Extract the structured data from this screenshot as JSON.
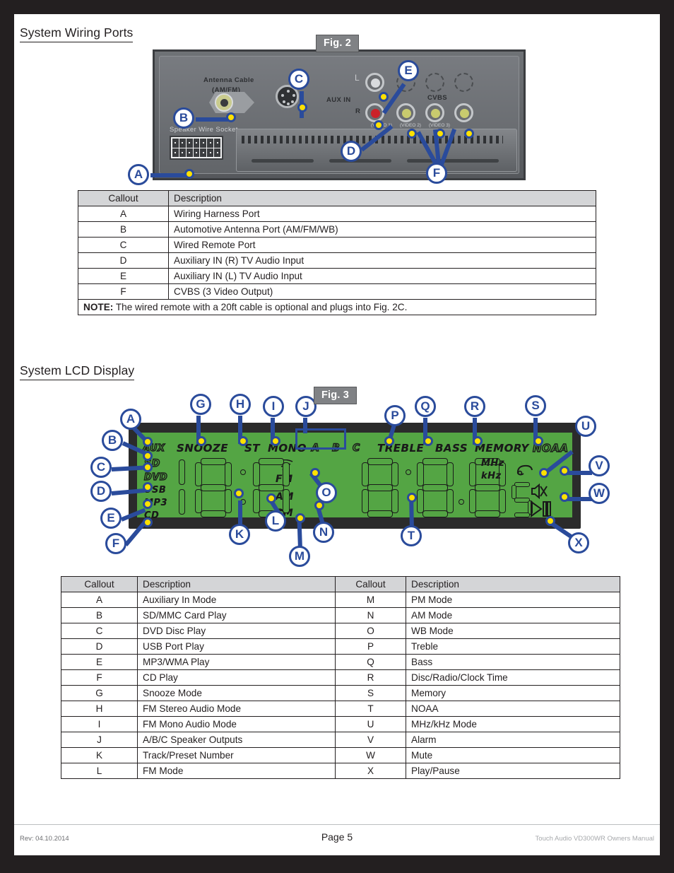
{
  "sections": {
    "wiring_title": "System Wiring Ports",
    "lcd_title": "System LCD Display"
  },
  "fig2": {
    "label": "Fig. 2",
    "panel_labels": {
      "antenna": "Antenna Cable",
      "antenna_sub": "(AM/FM)",
      "speaker_socket": "Speaker Wire Socket",
      "aux_in": "AUX IN",
      "left": "L",
      "right": "R",
      "cvbs": "CVBS",
      "video1": "(VIDEO 1)",
      "video2": "(VIDEO 2)",
      "video3": "(VIDEO 3)"
    },
    "callouts": [
      "A",
      "B",
      "C",
      "D",
      "E",
      "F"
    ]
  },
  "fig3": {
    "label": "Fig. 3",
    "lcd_labels": {
      "aux": "AUX",
      "sd": "SD",
      "dvd": "DVD",
      "usb": "USB",
      "mp3": "MP3",
      "cd": "CD",
      "snooze": "SNOOZE",
      "st": "ST",
      "mono": "MONO",
      "spk_a": "A",
      "spk_b": "B",
      "spk_c": "C",
      "treble": "TREBLE",
      "bass": "BASS",
      "memory": "MEMORY",
      "noaa": "NOAA",
      "mhz": "MHz",
      "khz": "kHz",
      "fm": "FM",
      "am": "AM",
      "pm": "PM"
    },
    "callouts": [
      "A",
      "B",
      "C",
      "D",
      "E",
      "F",
      "G",
      "H",
      "I",
      "J",
      "K",
      "L",
      "M",
      "N",
      "O",
      "P",
      "Q",
      "R",
      "S",
      "T",
      "U",
      "V",
      "W",
      "X"
    ]
  },
  "table1": {
    "headers": [
      "Callout",
      "Description"
    ],
    "rows": [
      [
        "A",
        "Wiring Harness Port"
      ],
      [
        "B",
        "Automotive Antenna Port (AM/FM/WB)"
      ],
      [
        "C",
        "Wired Remote Port"
      ],
      [
        "D",
        "Auxiliary IN (R) TV Audio Input"
      ],
      [
        "E",
        "Auxiliary IN (L) TV Audio Input"
      ],
      [
        "F",
        "CVBS (3 Video Output)"
      ]
    ],
    "note_label": "NOTE:",
    "note_text": " The wired remote with a 20ft cable is optional and plugs into Fig. 2C."
  },
  "table2": {
    "headers": [
      "Callout",
      "Description",
      "Callout",
      "Description"
    ],
    "rows": [
      [
        "A",
        "Auxiliary In Mode",
        "M",
        "PM Mode"
      ],
      [
        "B",
        "SD/MMC Card Play",
        "N",
        "AM Mode"
      ],
      [
        "C",
        "DVD Disc Play",
        "O",
        "WB Mode"
      ],
      [
        "D",
        "USB Port Play",
        "P",
        "Treble"
      ],
      [
        "E",
        "MP3/WMA Play",
        "Q",
        "Bass"
      ],
      [
        "F",
        "CD Play",
        "R",
        "Disc/Radio/Clock Time"
      ],
      [
        "G",
        "Snooze Mode",
        "S",
        "Memory"
      ],
      [
        "H",
        "FM Stereo Audio Mode",
        "T",
        "NOAA"
      ],
      [
        "I",
        "FM Mono Audio Mode",
        "U",
        "MHz/kHz Mode"
      ],
      [
        "J",
        "A/B/C Speaker Outputs",
        "V",
        "Alarm"
      ],
      [
        "K",
        "Track/Preset Number",
        "W",
        "Mute"
      ],
      [
        "L",
        "FM Mode",
        "X",
        "Play/Pause"
      ]
    ]
  },
  "footer": {
    "revision": "Rev: 04.10.2014",
    "page": "Page 5",
    "manual": "Touch Audio VD300WR Owners Manual"
  },
  "colors": {
    "callout_blue": "#2a4b9b",
    "dot_yellow": "#ffe100",
    "lcd_green": "#54a544",
    "header_gray": "#d4d5d7",
    "frame_dark": "#231f20"
  }
}
